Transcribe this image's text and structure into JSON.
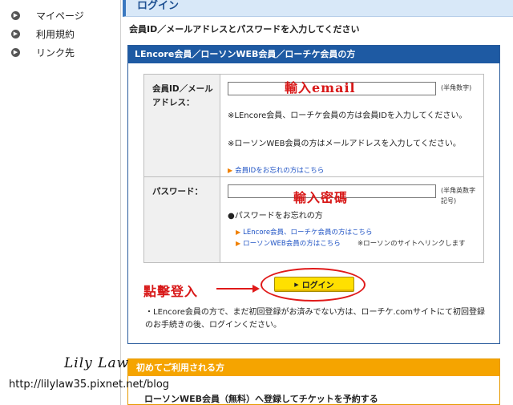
{
  "leftnav": {
    "items": [
      {
        "label": "マイページ"
      },
      {
        "label": "利用規約"
      },
      {
        "label": "リンク先"
      }
    ]
  },
  "main": {
    "section_title": "ログイン",
    "subtitle": "会員ID／メールアドレスとパスワードを入力してください",
    "panel_title": "LEncore会員／ローソンWEB会員／ローチケ会員の方",
    "member_id": {
      "label": "会員ID／メールアドレス：",
      "value": "",
      "hint": "(半角数字)",
      "note1": "※LEncore会員、ローチケ会員の方は会員IDを入力してください。",
      "note2": "※ローソンWEB会員の方はメールアドレスを入力してください。",
      "forgot_link": "会員IDをお忘れの方はこちら"
    },
    "password": {
      "label": "パスワード：",
      "value": "",
      "hint": "(半角英数字記号)",
      "forgot_heading": "●パスワードをお忘れの方",
      "link1": "LEncore会員、ローチケ会員の方はこちら",
      "link2": "ローソンWEB会員の方はこちら",
      "link2_note": "※ローソンのサイトへリンクします"
    },
    "login_button": "ログイン",
    "bottom_note": "・LEncore会員の方で、まだ初回登録がお済みでない方は、ローチケ.comサイトにて初回登録のお手続きの後、ログインください。"
  },
  "first_time": {
    "title": "初めてご利用される方",
    "text": "ローソンWEB会員（無料）へ登録してチケットを予約する"
  },
  "annotations": {
    "email": "輸入email",
    "password": "輸入密碼",
    "click_login": "點擊登入"
  },
  "watermark": {
    "name": "Lily Law",
    "url": "http://lilylaw35.pixnet.net/blog"
  }
}
